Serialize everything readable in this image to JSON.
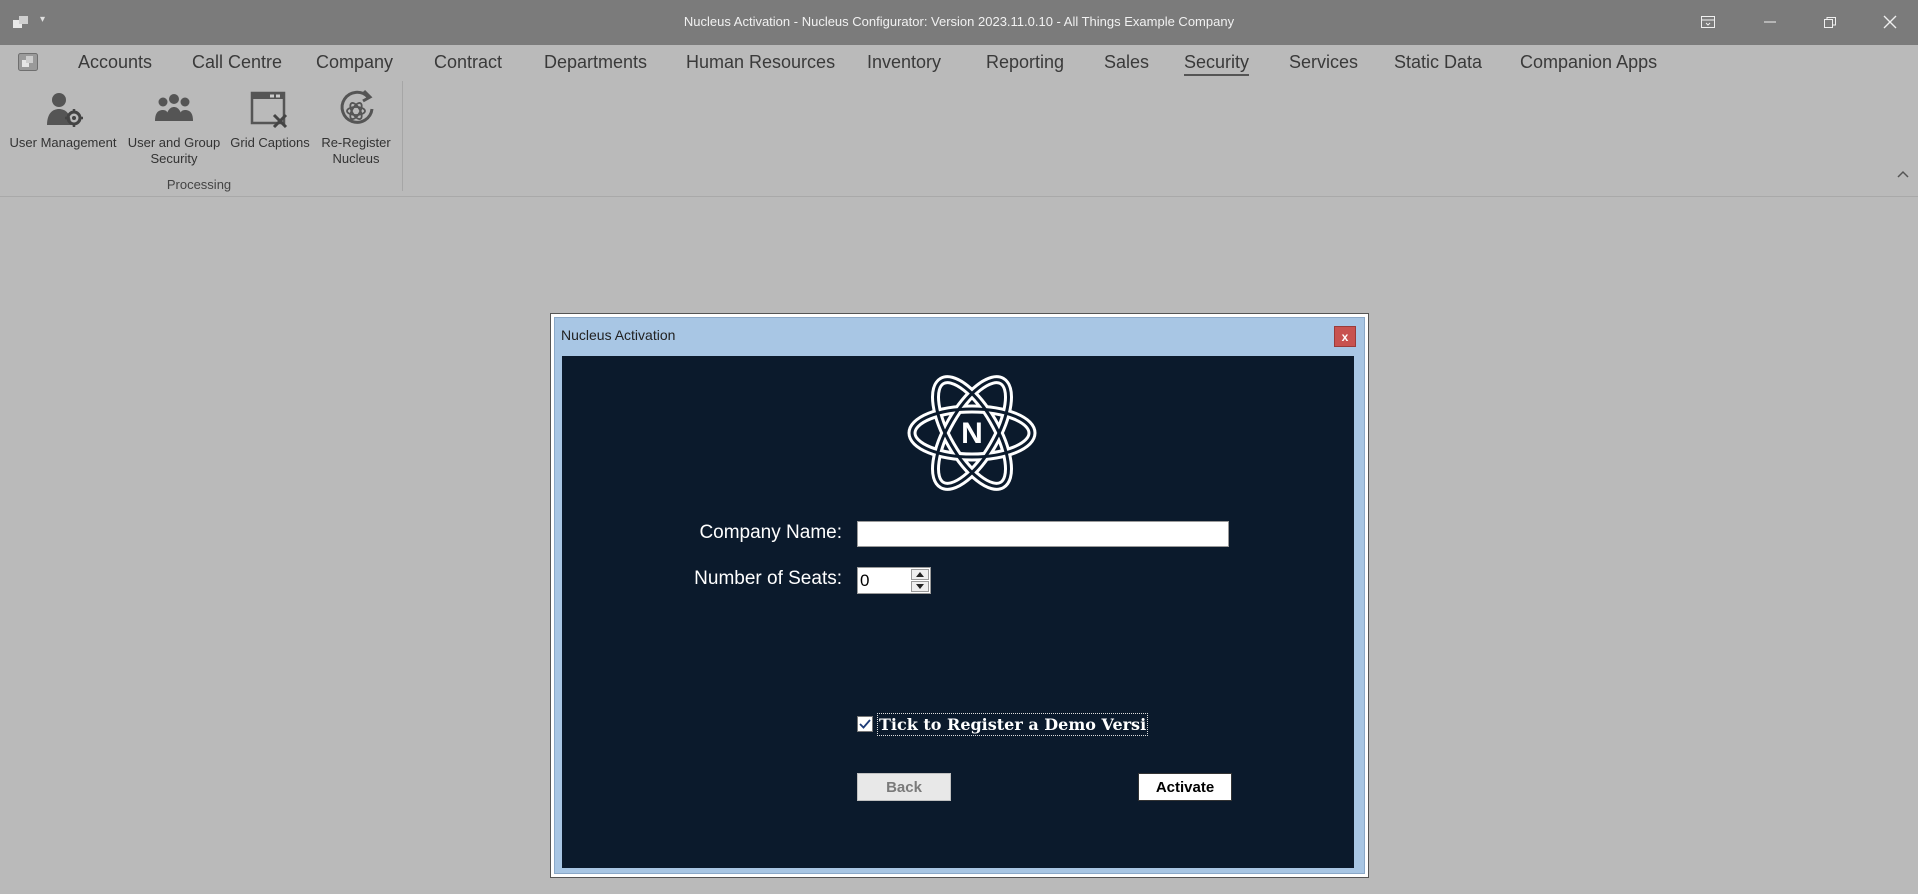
{
  "window": {
    "title": "Nucleus Activation - Nucleus Configurator: Version 2023.11.0.10 - All Things Example Company"
  },
  "menu": {
    "tabs": [
      {
        "label": "Accounts"
      },
      {
        "label": "Call Centre"
      },
      {
        "label": "Company"
      },
      {
        "label": "Contract"
      },
      {
        "label": "Departments"
      },
      {
        "label": "Human Resources"
      },
      {
        "label": "Inventory"
      },
      {
        "label": "Reporting"
      },
      {
        "label": "Sales"
      },
      {
        "label": "Security"
      },
      {
        "label": "Services"
      },
      {
        "label": "Static Data"
      },
      {
        "label": "Companion Apps"
      }
    ],
    "active": "Security"
  },
  "ribbon": {
    "buttons": [
      {
        "label": "User Management",
        "icon": "user-gear-icon"
      },
      {
        "label": "User and Group Security",
        "icon": "users-group-icon"
      },
      {
        "label": "Grid Captions",
        "icon": "grid-tools-icon"
      },
      {
        "label": "Re-Register Nucleus",
        "icon": "reregister-icon"
      }
    ],
    "group_label": "Processing"
  },
  "dialog": {
    "title": "Nucleus Activation",
    "close_label": "x",
    "logo_letter": "N",
    "company_name_label": "Company Name:",
    "company_name_value": "",
    "seats_label": "Number of Seats:",
    "seats_value": "0",
    "demo_checkbox_label": "Tick to Register a Demo Versi",
    "demo_checked": true,
    "back_label": "Back",
    "activate_label": "Activate"
  },
  "colors": {
    "dialog_body": "#0b1a2c",
    "dialog_frame": "#a8c6e4",
    "close_button": "#c8524f",
    "titlebar": "#7b7b7b",
    "background": "#bababa"
  }
}
